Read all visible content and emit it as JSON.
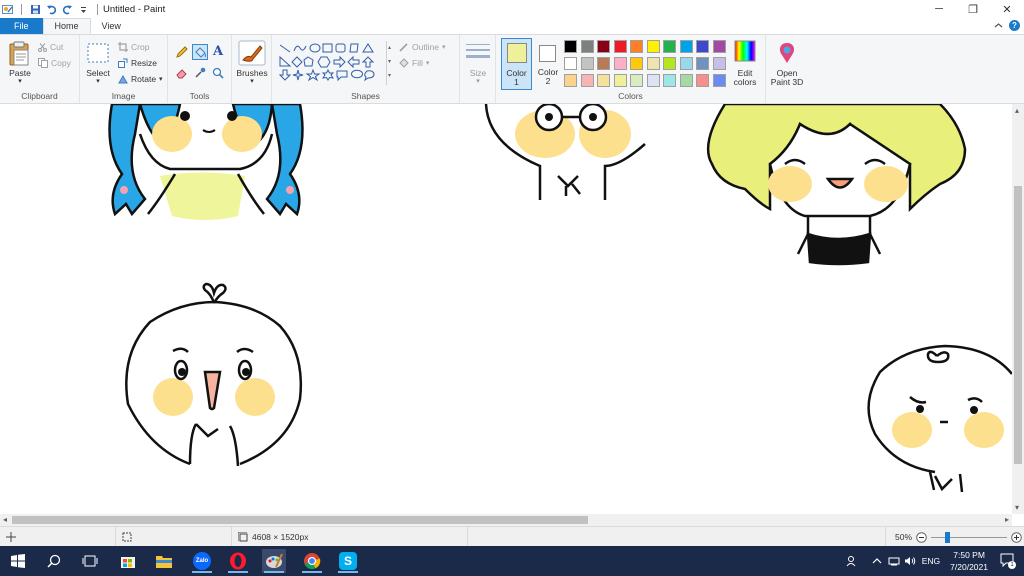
{
  "window": {
    "title": "Untitled - Paint",
    "controls": {
      "minimize": "─",
      "maximize": "❐",
      "close": "✕"
    }
  },
  "tabs": {
    "file": "File",
    "home": "Home",
    "view": "View"
  },
  "clipboard": {
    "paste": "Paste",
    "cut": "Cut",
    "copy": "Copy",
    "label": "Clipboard"
  },
  "image": {
    "select": "Select",
    "crop": "Crop",
    "resize": "Resize",
    "rotate": "Rotate",
    "label": "Image"
  },
  "tools": {
    "label": "Tools"
  },
  "brushes": {
    "label": "Brushes"
  },
  "shapes": {
    "outline": "Outline",
    "fill": "Fill",
    "label": "Shapes"
  },
  "size": {
    "label": "Size"
  },
  "colors": {
    "color1_label": "Color",
    "color1_num": "1",
    "color2_label": "Color",
    "color2_num": "2",
    "edit_label": "Edit",
    "edit_label2": "colors",
    "label": "Colors",
    "color1_value": "#eef09a",
    "color2_value": "#ffffff",
    "palette_row1": [
      "#000000",
      "#7f7f7f",
      "#880015",
      "#ed1c24",
      "#ff7f27",
      "#fff200",
      "#22b14c",
      "#00a2e8",
      "#3f48cc",
      "#a349a4"
    ],
    "palette_row2": [
      "#ffffff",
      "#c3c3c3",
      "#b97a57",
      "#ffaec9",
      "#ffc90e",
      "#efe4b0",
      "#b5e61d",
      "#99d9ea",
      "#7092be",
      "#c8bfe7"
    ],
    "palette_row3": [
      "#fbd38d",
      "#f5b5b5",
      "#f4e29c",
      "#eef09a",
      "#d7ecc1",
      "#dde3f2",
      "#9ee6e6",
      "#a7d9a4",
      "#f88f8f",
      "#6a8cf0"
    ]
  },
  "paint3d": {
    "label1": "Open",
    "label2": "Paint 3D"
  },
  "statusbar": {
    "dimensions": "4608 × 1520px",
    "zoom": "50%"
  },
  "taskbar": {
    "time": "7:50 PM",
    "date": "7/20/2021",
    "lang": "ENG",
    "notif_count": "1",
    "zalo": "Zalo"
  },
  "palette_accent": "#1979ca"
}
